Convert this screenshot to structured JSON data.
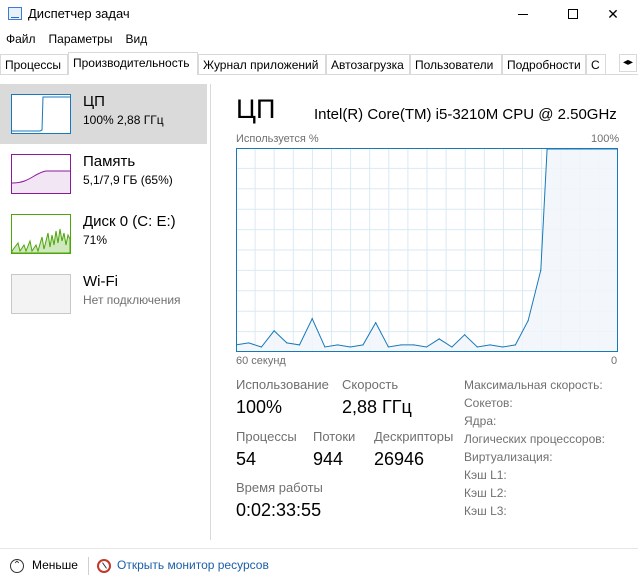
{
  "window": {
    "title": "Диспетчер задач",
    "min_glyph": "—",
    "max_glyph": "☐",
    "close_glyph": "✕"
  },
  "menu": [
    "Файл",
    "Параметры",
    "Вид"
  ],
  "tabs": [
    {
      "label": "Процессы"
    },
    {
      "label": "Производительность",
      "active": true
    },
    {
      "label": "Журнал приложений"
    },
    {
      "label": "Автозагрузка"
    },
    {
      "label": "Пользователи"
    },
    {
      "label": "Подробности"
    },
    {
      "label": "С"
    }
  ],
  "tab_scroll_glyph": "◂▸",
  "sidebar": {
    "items": [
      {
        "title": "ЦП",
        "sub": "100% 2,88 ГГц",
        "color": "#1779ba"
      },
      {
        "title": "Память",
        "sub": "5,1/7,9 ГБ (65%)",
        "color": "#8b1a9b"
      },
      {
        "title": "Диск 0 (C: E:)",
        "sub": "71%",
        "color": "#4da60c"
      },
      {
        "title": "Wi-Fi",
        "sub": "Нет подключения",
        "color": "#b8b8b8"
      }
    ]
  },
  "main": {
    "title": "ЦП",
    "cpu_name": "Intel(R) Core(TM) i5-3210M CPU @ 2.50GHz",
    "chart_top_left": "Используется %",
    "chart_top_right": "100%",
    "chart_bottom_left": "60 секунд",
    "chart_bottom_right": "0",
    "stats": {
      "usage_label": "Использование",
      "usage_value": "100%",
      "speed_label": "Скорость",
      "speed_value": "2,88 ГГц",
      "processes_label": "Процессы",
      "processes_value": "54",
      "threads_label": "Потоки",
      "threads_value": "944",
      "handles_label": "Дескрипторы",
      "handles_value": "26946",
      "uptime_label": "Время работы",
      "uptime_value": "0:02:33:55"
    },
    "specs": [
      "Максимальная скорость:",
      "Сокетов:",
      "Ядра:",
      "Логических процессоров:",
      "Виртуализация:",
      "Кэш L1:",
      "Кэш L2:",
      "Кэш L3:"
    ]
  },
  "footer": {
    "less_label": "Меньше",
    "resmon_label": "Открыть монитор ресурсов"
  },
  "chart_data": {
    "type": "area",
    "x": [
      60,
      58,
      56,
      54,
      52,
      50,
      48,
      46,
      44,
      42,
      40,
      38,
      36,
      34,
      32,
      30,
      28,
      26,
      24,
      22,
      20,
      18,
      16,
      14,
      12,
      11,
      10,
      8,
      6,
      4,
      2,
      0
    ],
    "values": [
      3,
      4,
      2,
      10,
      4,
      3,
      16,
      2,
      3,
      2,
      3,
      14,
      2,
      3,
      3,
      2,
      6,
      2,
      8,
      2,
      3,
      2,
      3,
      15,
      40,
      100,
      100,
      100,
      100,
      100,
      100,
      100
    ],
    "ylim": [
      0,
      100
    ],
    "line_color": "#1779ba",
    "fill_color": "#f1f6fa",
    "grid_color": "#d9eaf4",
    "grid": true
  }
}
